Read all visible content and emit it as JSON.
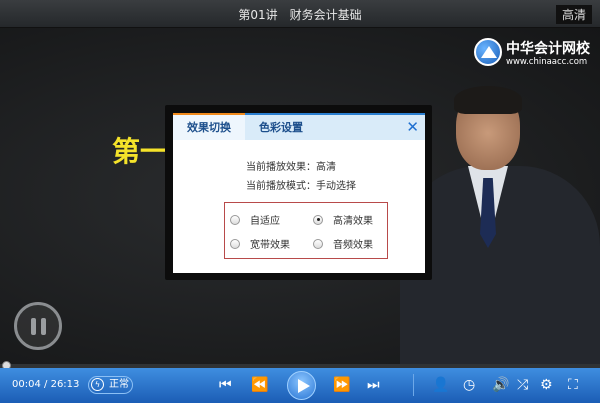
{
  "header": {
    "title": "第01讲　财务会计基础",
    "quality": "高清"
  },
  "logo": {
    "name": "中华会计网校",
    "url": "www.chinaacc.com"
  },
  "slide": {
    "text": "第一"
  },
  "dialog": {
    "tabs": [
      {
        "label": "效果切换"
      },
      {
        "label": "色彩设置"
      }
    ],
    "close": "✕",
    "current_effect": "当前播放效果：高清",
    "current_mode": "当前播放模式：手动选择",
    "options": [
      {
        "label": "自适应",
        "checked": false
      },
      {
        "label": "高清效果",
        "checked": true
      },
      {
        "label": "宽带效果",
        "checked": false
      },
      {
        "label": "音频效果",
        "checked": false
      }
    ]
  },
  "player": {
    "current_time": "00:04",
    "total_time": "26:13",
    "time_sep": "/",
    "speed": "正常",
    "progress_fraction": 0.0025
  }
}
